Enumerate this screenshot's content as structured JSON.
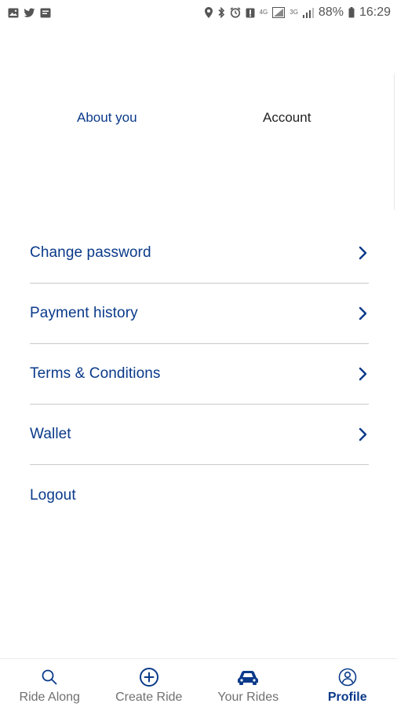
{
  "status_bar": {
    "battery_percent": "88%",
    "time": "16:29",
    "network_4g": "4G",
    "network_3g": "3G",
    "icons_left": [
      "gallery-icon",
      "twitter-icon",
      "message-icon"
    ],
    "icons_right": [
      "location-icon",
      "bluetooth-icon",
      "alarm-icon",
      "notification-icon",
      "signal-icon",
      "battery-icon"
    ]
  },
  "tabs": [
    {
      "label": "About you",
      "active": false
    },
    {
      "label": "Account",
      "active": true
    }
  ],
  "menu": [
    {
      "label": "Change password",
      "has_chevron": true
    },
    {
      "label": "Payment history",
      "has_chevron": true
    },
    {
      "label": "Terms & Conditions",
      "has_chevron": true
    },
    {
      "label": "Wallet",
      "has_chevron": true
    },
    {
      "label": "Logout",
      "has_chevron": false
    }
  ],
  "bottom_nav": [
    {
      "label": "Ride Along",
      "icon": "search-icon",
      "active": false
    },
    {
      "label": "Create Ride",
      "icon": "plus-circle-icon",
      "active": false
    },
    {
      "label": "Your Rides",
      "icon": "car-icon",
      "active": false
    },
    {
      "label": "Profile",
      "icon": "profile-icon",
      "active": true
    }
  ],
  "colors": {
    "primary": "#0a3a8a",
    "text_dark": "#222222",
    "nav_inactive": "#707070",
    "divider": "#c9c9c9"
  }
}
